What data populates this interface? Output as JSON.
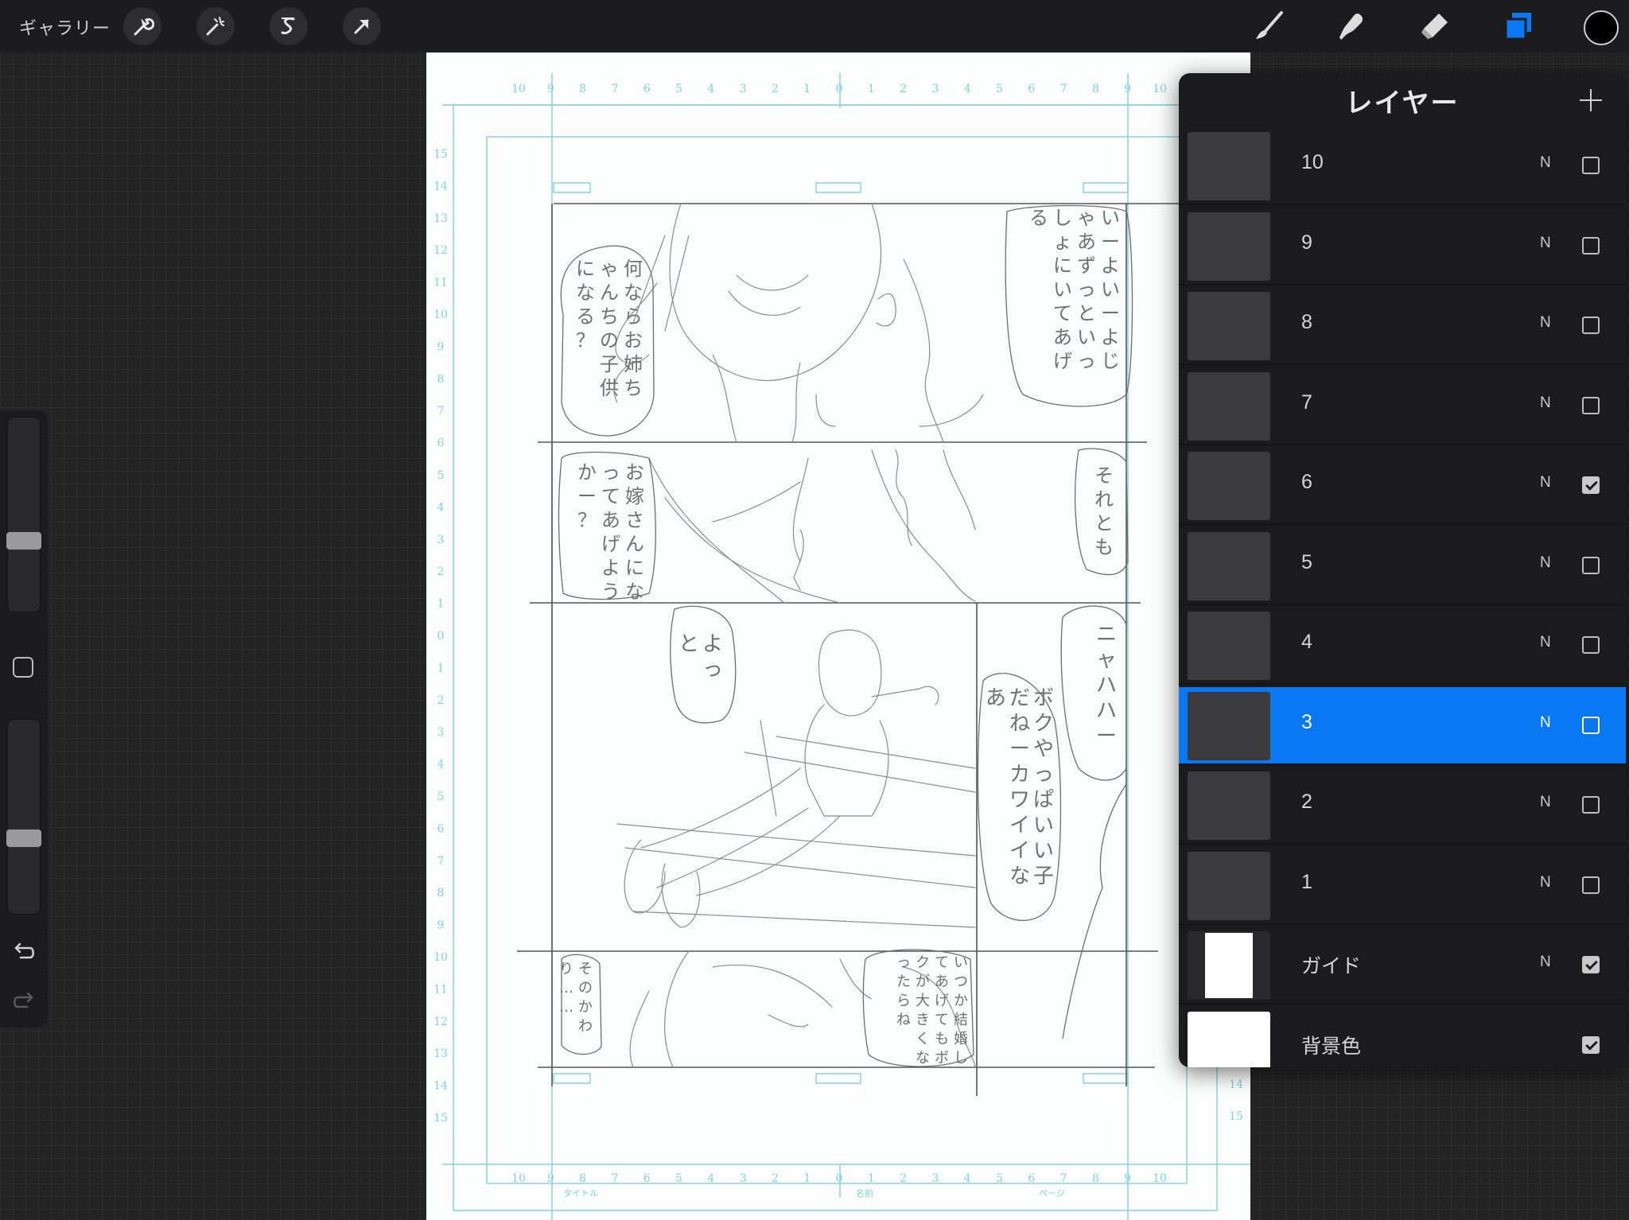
{
  "toolbar": {
    "gallery_label": "ギャラリー",
    "left_tools": [
      {
        "name": "actions",
        "icon": "wrench-icon"
      },
      {
        "name": "adjustments",
        "icon": "magic-wand-icon"
      },
      {
        "name": "selection",
        "icon": "selection-s-icon"
      },
      {
        "name": "transform",
        "icon": "arrow-cursor-icon"
      }
    ],
    "right_tools": [
      {
        "name": "brush",
        "icon": "brush-icon"
      },
      {
        "name": "smudge",
        "icon": "smudge-icon"
      },
      {
        "name": "eraser",
        "icon": "eraser-icon"
      },
      {
        "name": "layers",
        "icon": "layers-icon",
        "active": true
      }
    ],
    "current_color": "#000000",
    "accent_color": "#0a78f2"
  },
  "sidebar": {
    "brush_size_level": 0.4,
    "opacity_level": 0.43,
    "undo_icon": "undo-icon",
    "redo_icon": "redo-icon"
  },
  "layers": {
    "title": "レイヤー",
    "add_icon": "plus-icon",
    "items": [
      {
        "name": "10",
        "mode": "N",
        "visible": false,
        "selected": false
      },
      {
        "name": "9",
        "mode": "N",
        "visible": false,
        "selected": false
      },
      {
        "name": "8",
        "mode": "N",
        "visible": false,
        "selected": false
      },
      {
        "name": "7",
        "mode": "N",
        "visible": false,
        "selected": false
      },
      {
        "name": "6",
        "mode": "N",
        "visible": true,
        "selected": false
      },
      {
        "name": "5",
        "mode": "N",
        "visible": false,
        "selected": false
      },
      {
        "name": "4",
        "mode": "N",
        "visible": false,
        "selected": false
      },
      {
        "name": "3",
        "mode": "N",
        "visible": false,
        "selected": true
      },
      {
        "name": "2",
        "mode": "N",
        "visible": false,
        "selected": false
      },
      {
        "name": "1",
        "mode": "N",
        "visible": false,
        "selected": false
      },
      {
        "name": "ガイド",
        "mode": "N",
        "visible": true,
        "selected": false
      },
      {
        "name": "背景色",
        "mode": "",
        "visible": true,
        "selected": false
      }
    ]
  },
  "canvas": {
    "ruler_top": [
      "10",
      "9",
      "8",
      "7",
      "6",
      "5",
      "4",
      "3",
      "2",
      "1",
      "0",
      "1",
      "2",
      "3",
      "4",
      "5",
      "6",
      "7",
      "8",
      "9",
      "10"
    ],
    "ruler_left": [
      "15",
      "14",
      "13",
      "12",
      "11",
      "10",
      "9",
      "8",
      "7",
      "6",
      "5",
      "4",
      "3",
      "2",
      "1",
      "0",
      "1",
      "2",
      "3",
      "4",
      "5",
      "6",
      "7",
      "8",
      "9",
      "10",
      "11",
      "12",
      "13",
      "14",
      "15"
    ],
    "ruler_right": [
      "14",
      "15"
    ],
    "bottom_labels": [
      "タイトル",
      "名前",
      "ページ"
    ],
    "speech_text": [
      "何ならお姉ちゃんちの子供になる？",
      "いーよいーよじゃあずっといっしょにいてあげる",
      "お嫁さんになってあげようかー？",
      "それとも",
      "よっと",
      "ニャハハー",
      "ボクやっぱいい子だねーカワイイなあ",
      "そのかわり……",
      "いつか結婚してあげてもボクが大きくなったらね"
    ]
  }
}
